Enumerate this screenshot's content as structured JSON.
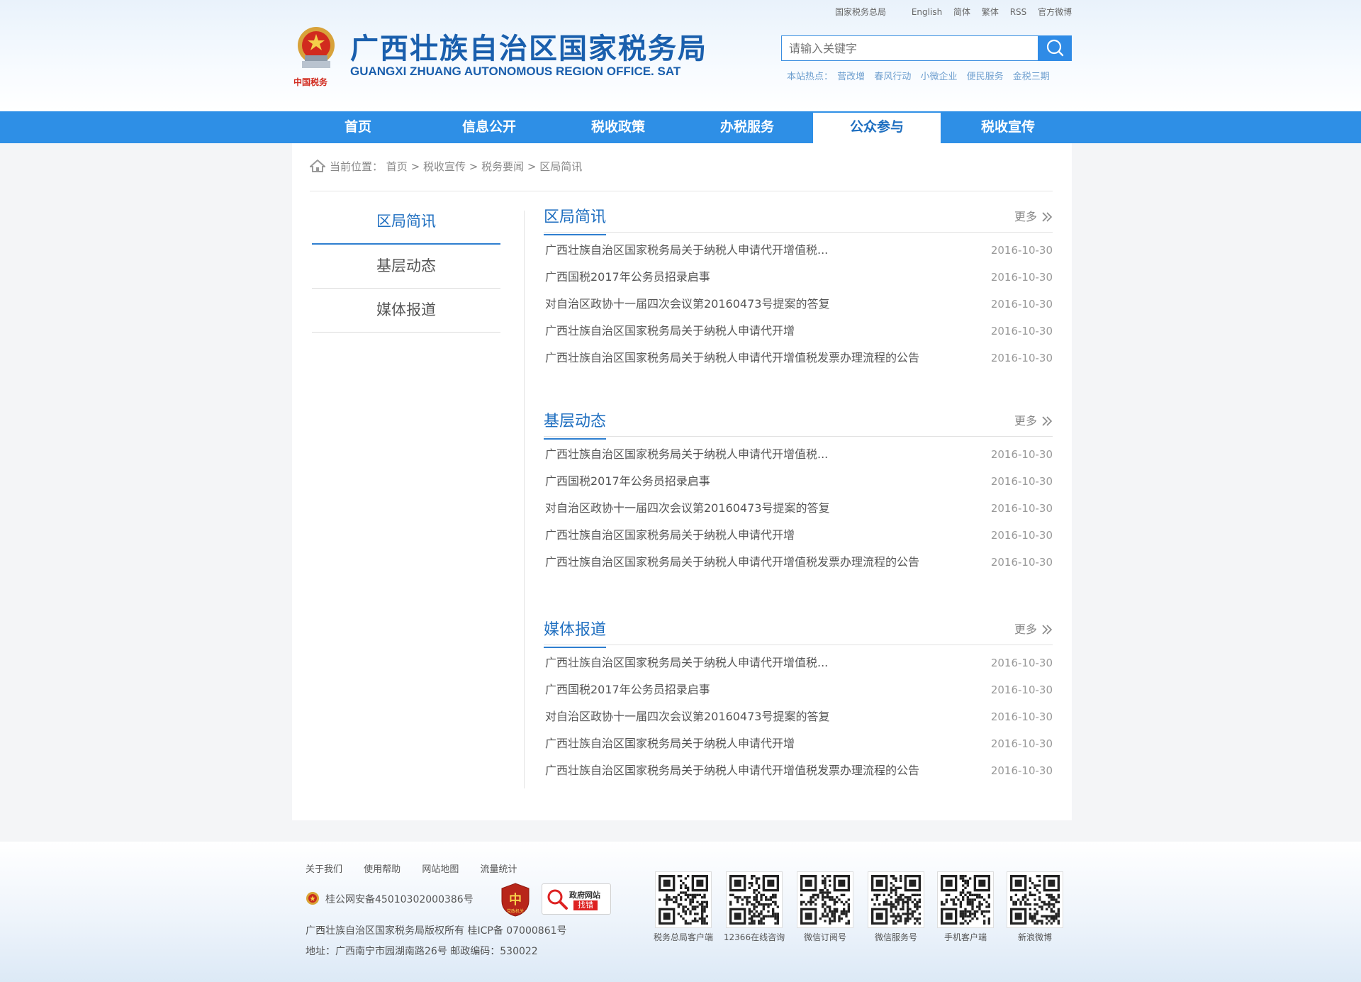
{
  "header": {
    "title": "广西壮族自治区国家税务局",
    "subtitle": "GUANGXI ZHUANG AUTONOMOUS REGION OFFICE. SAT",
    "emblem_caption": "中国税务",
    "toplinks": [
      "国家税务总局",
      "English",
      "简体",
      "繁体",
      "RSS",
      "官方微博"
    ],
    "search_placeholder": "请输入关键字",
    "hot_label": "本站热点：",
    "hot_links": [
      "营改增",
      "春风行动",
      "小微企业",
      "便民服务",
      "金税三期"
    ]
  },
  "nav": {
    "items": [
      "首页",
      "信息公开",
      "税收政策",
      "办税服务",
      "公众参与",
      "税收宣传"
    ],
    "active_index": 4
  },
  "breadcrumb": {
    "prefix": "当前位置：",
    "path": [
      "首页",
      "税收宣传",
      "税务要闻",
      "区局简讯"
    ],
    "sep": ">"
  },
  "sidebar": {
    "items": [
      "区局简讯",
      "基层动态",
      "媒体报道"
    ],
    "active_index": 0
  },
  "sections": [
    {
      "title": "区局简讯",
      "more": "更多",
      "items": [
        {
          "title": "广西壮族自治区国家税务局关于纳税人申请代开增值税...",
          "date": "2016-10-30"
        },
        {
          "title": "广西国税2017年公务员招录启事",
          "date": "2016-10-30"
        },
        {
          "title": "对自治区政协十一届四次会议第20160473号提案的答复",
          "date": "2016-10-30"
        },
        {
          "title": "广西壮族自治区国家税务局关于纳税人申请代开增",
          "date": "2016-10-30"
        },
        {
          "title": "广西壮族自治区国家税务局关于纳税人申请代开增值税发票办理流程的公告",
          "date": "2016-10-30"
        }
      ]
    },
    {
      "title": "基层动态",
      "more": "更多",
      "items": [
        {
          "title": "广西壮族自治区国家税务局关于纳税人申请代开增值税...",
          "date": "2016-10-30"
        },
        {
          "title": "广西国税2017年公务员招录启事",
          "date": "2016-10-30"
        },
        {
          "title": "对自治区政协十一届四次会议第20160473号提案的答复",
          "date": "2016-10-30"
        },
        {
          "title": "广西壮族自治区国家税务局关于纳税人申请代开增",
          "date": "2016-10-30"
        },
        {
          "title": "广西壮族自治区国家税务局关于纳税人申请代开增值税发票办理流程的公告",
          "date": "2016-10-30"
        }
      ]
    },
    {
      "title": "媒体报道",
      "more": "更多",
      "items": [
        {
          "title": "广西壮族自治区国家税务局关于纳税人申请代开增值税...",
          "date": "2016-10-30"
        },
        {
          "title": "广西国税2017年公务员招录启事",
          "date": "2016-10-30"
        },
        {
          "title": "对自治区政协十一届四次会议第20160473号提案的答复",
          "date": "2016-10-30"
        },
        {
          "title": "广西壮族自治区国家税务局关于纳税人申请代开增",
          "date": "2016-10-30"
        },
        {
          "title": "广西壮族自治区国家税务局关于纳税人申请代开增值税发票办理流程的公告",
          "date": "2016-10-30"
        }
      ]
    }
  ],
  "footer": {
    "links": [
      "关于我们",
      "使用帮助",
      "网站地图",
      "流量统计"
    ],
    "beian": "桂公网安备45010302000386号",
    "badge_gov_top": "政府网站",
    "badge_gov_bottom": "找错",
    "badge_party": "党政机关",
    "copyright": "广西壮族自治区国家税务局版权所有 桂ICP备 07000861号",
    "address": "地址：广西南宁市园湖南路26号 邮政编码：530022",
    "qrcodes": [
      "税务总局客户端",
      "12366在线咨询",
      "微信订阅号",
      "微信服务号",
      "手机客户端",
      "新浪微博"
    ]
  }
}
